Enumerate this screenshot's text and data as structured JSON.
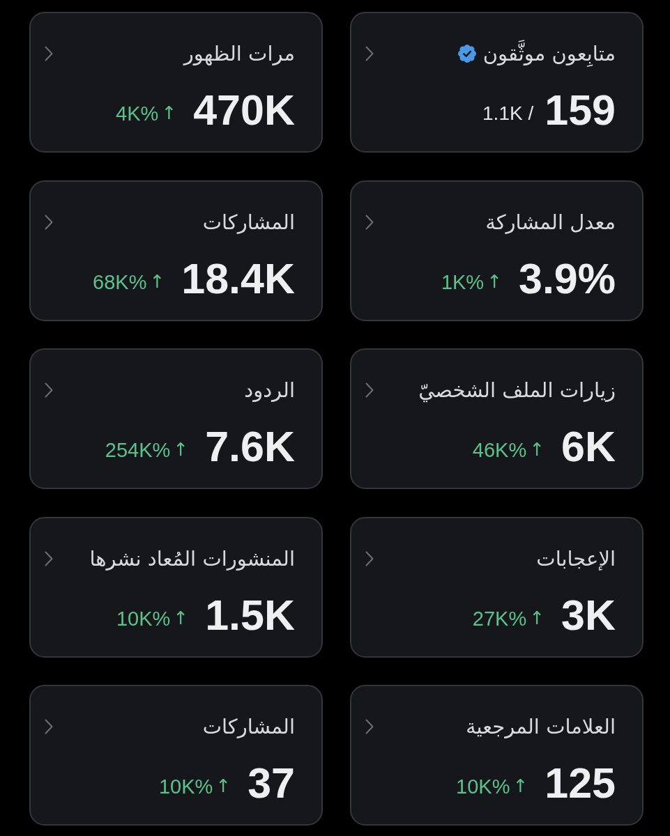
{
  "cards": [
    {
      "title": "متابِعون موثَّقون",
      "verified": true,
      "kind": "ratio",
      "value": "159",
      "total": "/ 1.1K"
    },
    {
      "title": "مرات الظهور",
      "verified": false,
      "kind": "change",
      "value": "470K",
      "change": "4K%",
      "arrow": "↑"
    },
    {
      "title": "معدل المشاركة",
      "verified": false,
      "kind": "change",
      "value": "3.9%",
      "change": "1K%",
      "arrow": "↑"
    },
    {
      "title": "المشاركات",
      "verified": false,
      "kind": "change",
      "value": "18.4K",
      "change": "68K%",
      "arrow": "↑"
    },
    {
      "title": "زيارات الملف الشخصيّ",
      "verified": false,
      "kind": "change",
      "value": "6K",
      "change": "46K%",
      "arrow": "↑"
    },
    {
      "title": "الردود",
      "verified": false,
      "kind": "change",
      "value": "7.6K",
      "change": "254K%",
      "arrow": "↑"
    },
    {
      "title": "الإعجابات",
      "verified": false,
      "kind": "change",
      "value": "3K",
      "change": "27K%",
      "arrow": "↑"
    },
    {
      "title": "المنشورات المُعاد نشرها",
      "verified": false,
      "kind": "change",
      "value": "1.5K",
      "change": "10K%",
      "arrow": "↑"
    },
    {
      "title": "العلامات المرجعية",
      "verified": false,
      "kind": "change",
      "value": "125",
      "change": "10K%",
      "arrow": "↑"
    },
    {
      "title": "المشاركات",
      "verified": false,
      "kind": "change",
      "value": "37",
      "change": "10K%",
      "arrow": "↑"
    }
  ]
}
